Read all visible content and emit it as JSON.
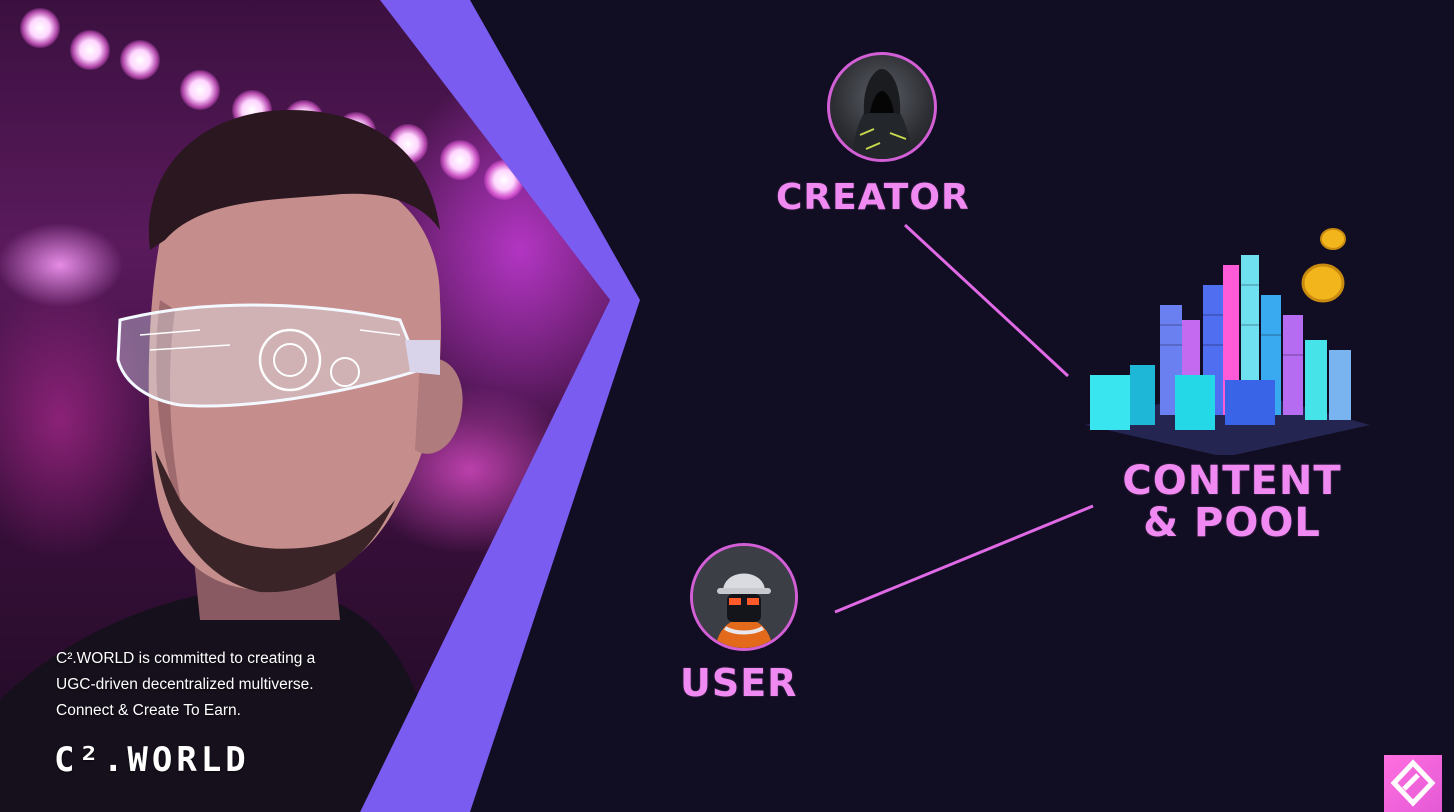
{
  "left_panel": {
    "tagline_lines": [
      "C².WORLD is committed to creating a",
      "UGC-driven decentralized multiverse.",
      "Connect & Create To Earn."
    ],
    "logo_text": "C².WORLD"
  },
  "diagram": {
    "creator_label": "CREATOR",
    "user_label": "USER",
    "content_label_line1": "CONTENT",
    "content_label_line2": "& POOL"
  },
  "colors": {
    "background": "#110d22",
    "accent_pink": "#f08af2",
    "accent_violet": "#7b5cf0",
    "connector_line": "#e06ae6"
  },
  "icons": {
    "corner_badge": "brand-diamond-icon"
  }
}
